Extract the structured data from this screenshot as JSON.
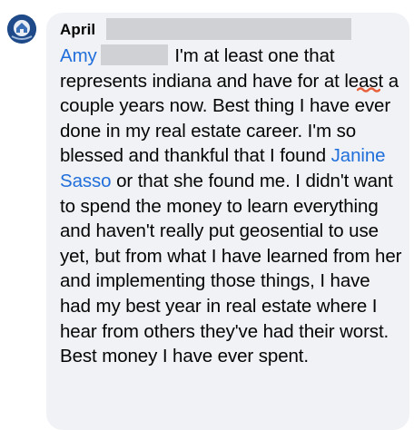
{
  "comment": {
    "author_name": "April",
    "mention_tag": "Amy",
    "text_1": "I'm at least one that represents indiana and have for at least a couple years now.  Best thing I have ever done in my real estate career.  I'm so blessed and thankful that I found ",
    "mention_name": "Janine Sasso",
    "text_2": " or that she found me.  I didn't want to spend the money to learn everything and haven't really put geosential to use yet, but from what I have learned from her and implementing those things, I have had my best year in real estate where I hear from others they've had their worst.  Best money I have ever spent."
  },
  "colors": {
    "bubble_bg": "#f0f2f5",
    "mention": "#216fdb",
    "text": "#050505",
    "redaction": "#cfd1d4",
    "spellcheck": "#e8603c"
  },
  "icons": {
    "avatar": "profile-avatar-icon",
    "spellcheck": "spellcheck-squiggle-icon"
  }
}
